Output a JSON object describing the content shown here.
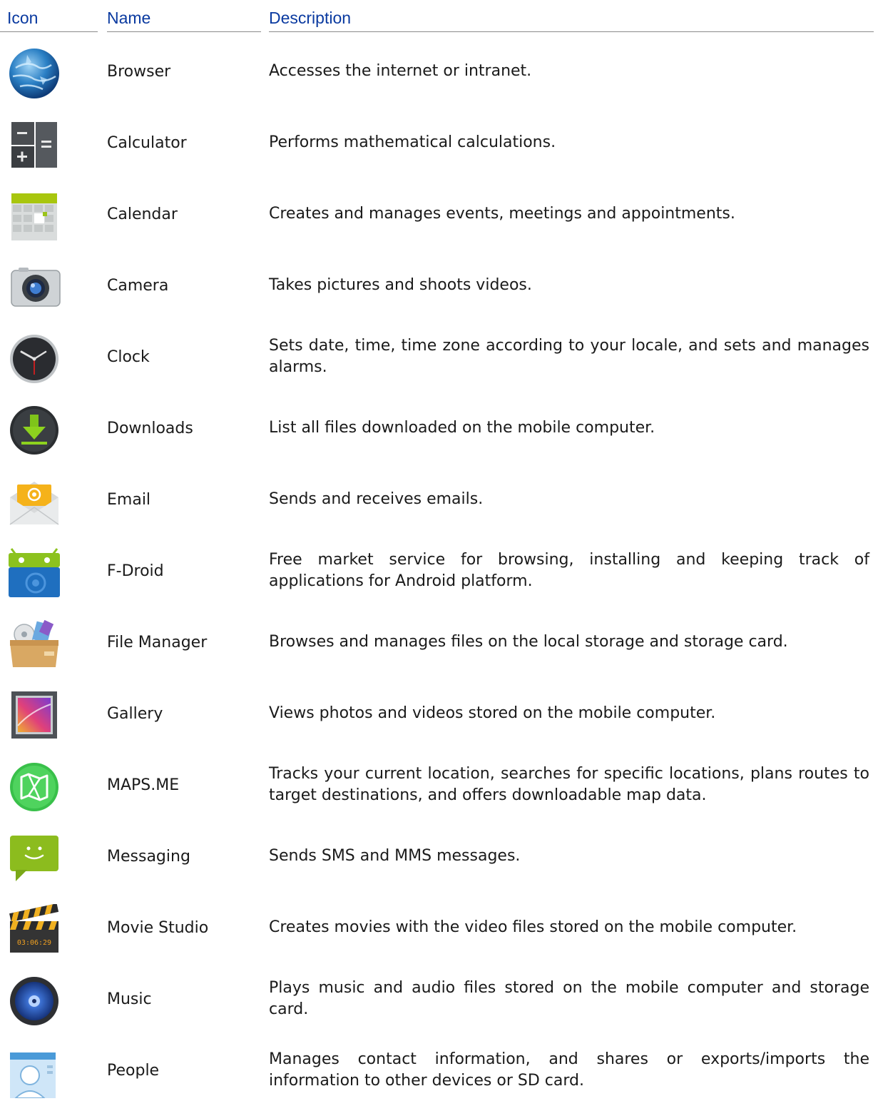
{
  "header": {
    "icon": "Icon",
    "name": "Name",
    "description": "Description"
  },
  "apps": [
    {
      "icon": "browser-icon",
      "name": "Browser",
      "description": "Accesses the internet or intranet."
    },
    {
      "icon": "calculator-icon",
      "name": "Calculator",
      "description": "Performs mathematical calculations."
    },
    {
      "icon": "calendar-icon",
      "name": "Calendar",
      "description": "Creates and manages events, meetings and appointments."
    },
    {
      "icon": "camera-icon",
      "name": "Camera",
      "description": "Takes pictures and shoots videos."
    },
    {
      "icon": "clock-icon",
      "name": "Clock",
      "description": "Sets date, time, time zone according to your locale, and sets and manages alarms."
    },
    {
      "icon": "downloads-icon",
      "name": "Downloads",
      "description": "List all files downloaded on the mobile computer."
    },
    {
      "icon": "email-icon",
      "name": "Email",
      "description": "Sends and receives emails."
    },
    {
      "icon": "fdroid-icon",
      "name": "F-Droid",
      "description": "Free market service for browsing, installing and keeping track of applications for Android platform."
    },
    {
      "icon": "file-manager-icon",
      "name": "File Manager",
      "description": "Browses and manages files on the local storage and storage card."
    },
    {
      "icon": "gallery-icon",
      "name": "Gallery",
      "description": "Views photos and videos stored on the mobile computer."
    },
    {
      "icon": "maps-icon",
      "name": "MAPS.ME",
      "description": "Tracks your current location, searches for specific locations, plans routes to target destinations, and offers downloadable map data."
    },
    {
      "icon": "messaging-icon",
      "name": "Messaging",
      "description": "Sends SMS and MMS messages."
    },
    {
      "icon": "movie-studio-icon",
      "name": "Movie Studio",
      "description": "Creates movies with the video files stored on the mobile computer."
    },
    {
      "icon": "music-icon",
      "name": "Music",
      "description": "Plays music and audio files stored on the mobile computer and storage card."
    },
    {
      "icon": "people-icon",
      "name": "People",
      "description": "Manages contact information, and shares or exports/imports the information to other devices or SD card."
    }
  ],
  "icon_texts": {
    "movie_studio_timecode": "03:06:29"
  }
}
